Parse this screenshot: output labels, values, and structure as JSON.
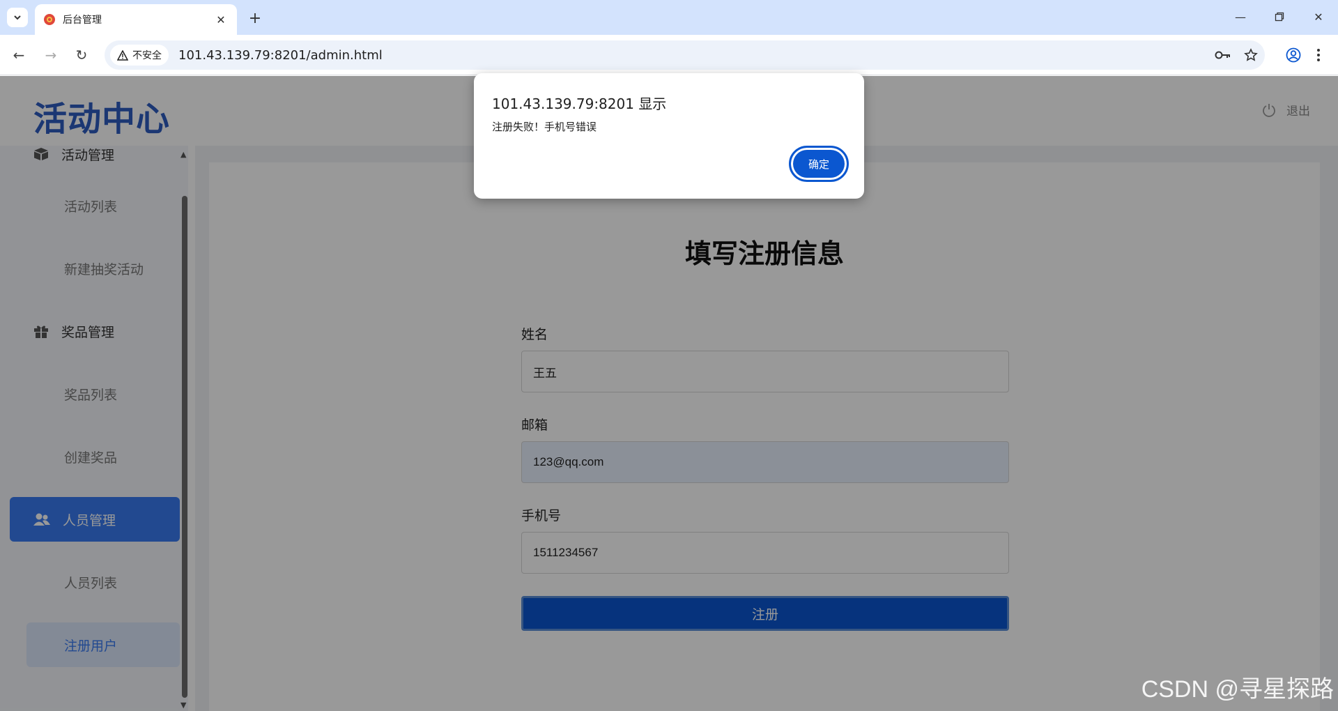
{
  "browser": {
    "tab_title": "后台管理",
    "security_label": "不安全",
    "url": "101.43.139.79:8201/admin.html"
  },
  "header": {
    "logo_text": "活动中心",
    "logout_label": "退出"
  },
  "sidebar": {
    "items": [
      {
        "label": "活动管理",
        "type": "group"
      },
      {
        "label": "活动列表",
        "type": "sub"
      },
      {
        "label": "新建抽奖活动",
        "type": "sub"
      },
      {
        "label": "奖品管理",
        "type": "group"
      },
      {
        "label": "奖品列表",
        "type": "sub"
      },
      {
        "label": "创建奖品",
        "type": "sub"
      },
      {
        "label": "人员管理",
        "type": "group",
        "active": true
      },
      {
        "label": "人员列表",
        "type": "sub"
      },
      {
        "label": "注册用户",
        "type": "sub",
        "active": true
      }
    ]
  },
  "form": {
    "title": "填写注册信息",
    "name_label": "姓名",
    "name_value": "王五",
    "email_label": "邮箱",
    "email_value": "123@qq.com",
    "phone_label": "手机号",
    "phone_value": "1511234567",
    "submit_label": "注册"
  },
  "dialog": {
    "origin": "101.43.139.79:8201 显示",
    "message": "注册失败！手机号错误",
    "ok_label": "确定"
  },
  "watermark": "CSDN @寻星探路",
  "colors": {
    "accent": "#3a7bf0",
    "dialog_button": "#0b57d0",
    "logo": "#2d5cc0"
  }
}
